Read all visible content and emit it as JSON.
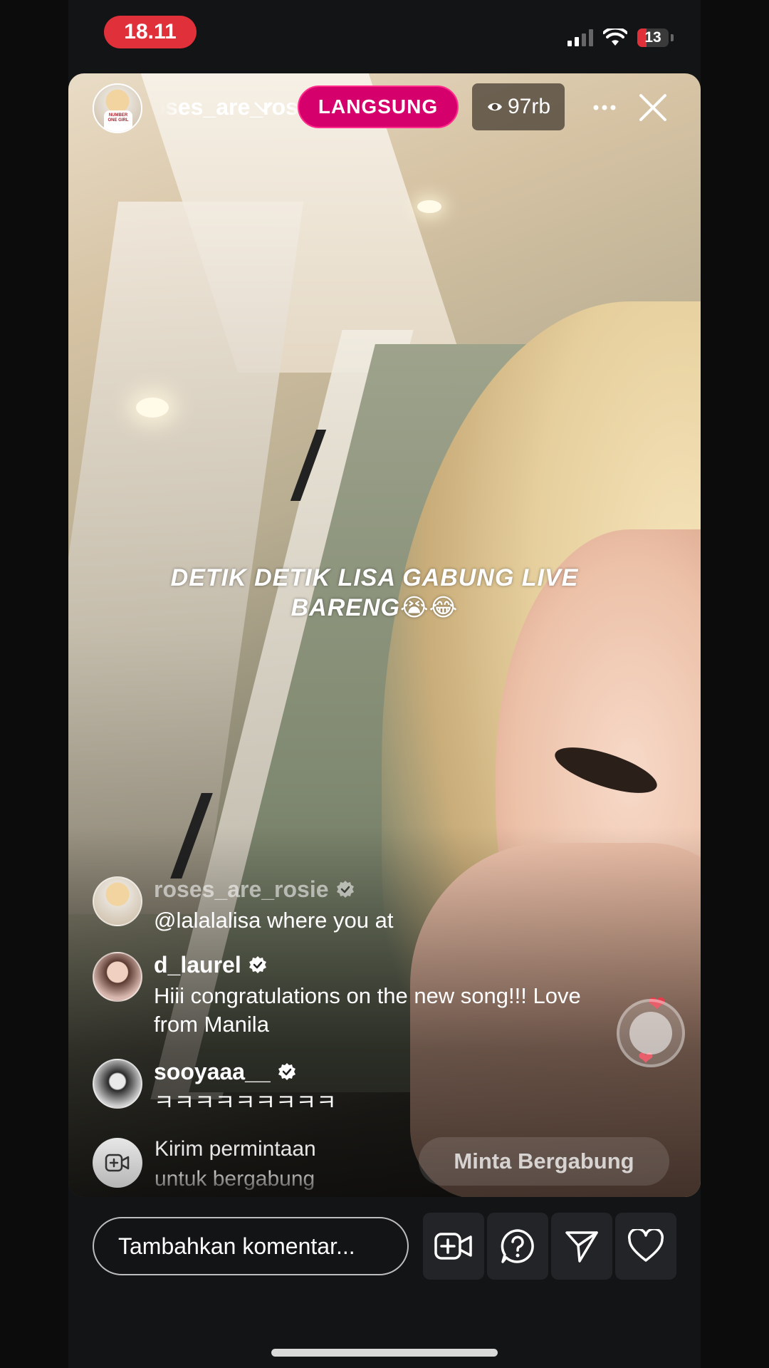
{
  "status_bar": {
    "time": "18.11",
    "battery": "13"
  },
  "header": {
    "host_username": "roses_are_rosie",
    "live_label": "LANGSUNG",
    "viewer_count": "97rb",
    "host_avatar_text": "NUMBER ONE GIRL"
  },
  "overlay_caption": "DETIK DETIK LISA GABUNG LIVE BARENG😭😂",
  "comments": [
    {
      "username": "roses_are_rosie",
      "text": "@lalalalisa where you at",
      "verified": true
    },
    {
      "username": "d_laurel",
      "text": "Hiii congratulations on the new song!!! Love from Manila",
      "verified": true
    },
    {
      "username": "sooyaaa__",
      "text": "ㅋㅋㅋㅋㅋㅋㅋㅋㅋ",
      "verified": true
    }
  ],
  "join_request": {
    "prompt": "Kirim permintaan untuk bergabung",
    "button_label": "Minta Bergabung"
  },
  "bottom_bar": {
    "comment_placeholder": "Tambahkan komentar..."
  },
  "colors": {
    "live_badge": "#d6006d",
    "status_time_bg": "#e0303a",
    "background": "#131416"
  },
  "icons": [
    "chevron-down-icon",
    "eye-icon",
    "more-icon",
    "close-icon",
    "verified-icon",
    "video-add-icon",
    "question-icon",
    "send-icon",
    "heart-icon"
  ]
}
